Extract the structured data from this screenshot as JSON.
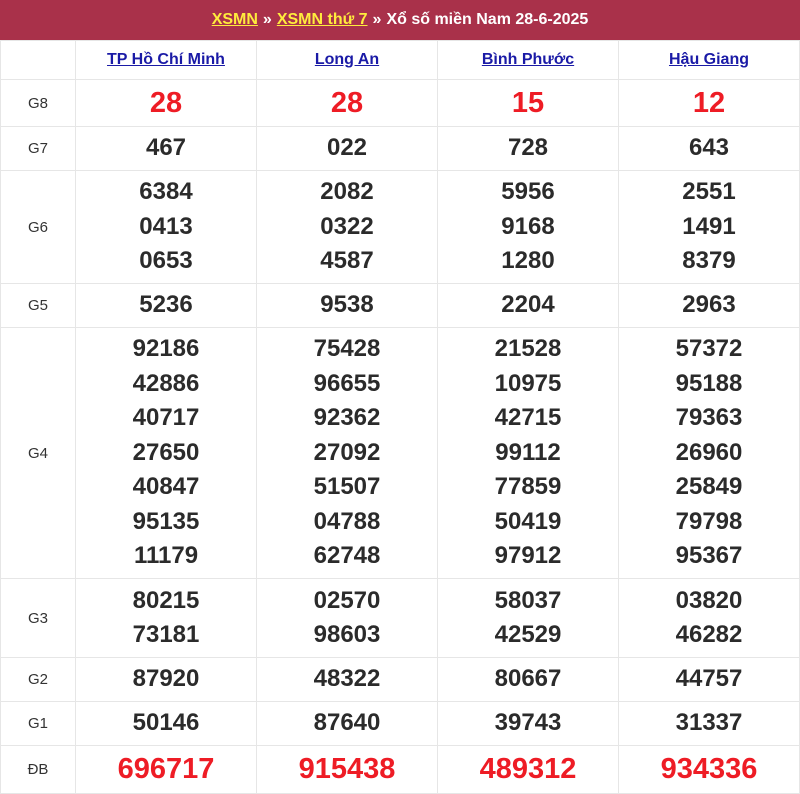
{
  "breadcrumb": {
    "link1": "XSMN",
    "sep1": "»",
    "link2": "XSMN thứ 7",
    "sep2": "»",
    "title": "Xổ số miền Nam 28-6-2025"
  },
  "provinces": [
    "TP Hồ Chí Minh",
    "Long An",
    "Bình Phước",
    "Hậu Giang"
  ],
  "prizes": [
    {
      "label": "G8",
      "values": [
        [
          "28"
        ],
        [
          "28"
        ],
        [
          "15"
        ],
        [
          "12"
        ]
      ]
    },
    {
      "label": "G7",
      "values": [
        [
          "467"
        ],
        [
          "022"
        ],
        [
          "728"
        ],
        [
          "643"
        ]
      ]
    },
    {
      "label": "G6",
      "values": [
        [
          "6384",
          "0413",
          "0653"
        ],
        [
          "2082",
          "0322",
          "4587"
        ],
        [
          "5956",
          "9168",
          "1280"
        ],
        [
          "2551",
          "1491",
          "8379"
        ]
      ]
    },
    {
      "label": "G5",
      "values": [
        [
          "5236"
        ],
        [
          "9538"
        ],
        [
          "2204"
        ],
        [
          "2963"
        ]
      ]
    },
    {
      "label": "G4",
      "values": [
        [
          "92186",
          "42886",
          "40717",
          "27650",
          "40847",
          "95135",
          "11179"
        ],
        [
          "75428",
          "96655",
          "92362",
          "27092",
          "51507",
          "04788",
          "62748"
        ],
        [
          "21528",
          "10975",
          "42715",
          "99112",
          "77859",
          "50419",
          "97912"
        ],
        [
          "57372",
          "95188",
          "79363",
          "26960",
          "25849",
          "79798",
          "95367"
        ]
      ]
    },
    {
      "label": "G3",
      "values": [
        [
          "80215",
          "73181"
        ],
        [
          "02570",
          "98603"
        ],
        [
          "58037",
          "42529"
        ],
        [
          "03820",
          "46282"
        ]
      ]
    },
    {
      "label": "G2",
      "values": [
        [
          "87920"
        ],
        [
          "48322"
        ],
        [
          "80667"
        ],
        [
          "44757"
        ]
      ]
    },
    {
      "label": "G1",
      "values": [
        [
          "50146"
        ],
        [
          "87640"
        ],
        [
          "39743"
        ],
        [
          "31337"
        ]
      ]
    },
    {
      "label": "ĐB",
      "values": [
        [
          "696717"
        ],
        [
          "915438"
        ],
        [
          "489312"
        ],
        [
          "934336"
        ]
      ]
    }
  ],
  "colors": {
    "header_bg": "#a9314a",
    "header_link": "#ffec3d",
    "highlight_red": "#ee1c25",
    "province_link": "#1a1aa6"
  }
}
